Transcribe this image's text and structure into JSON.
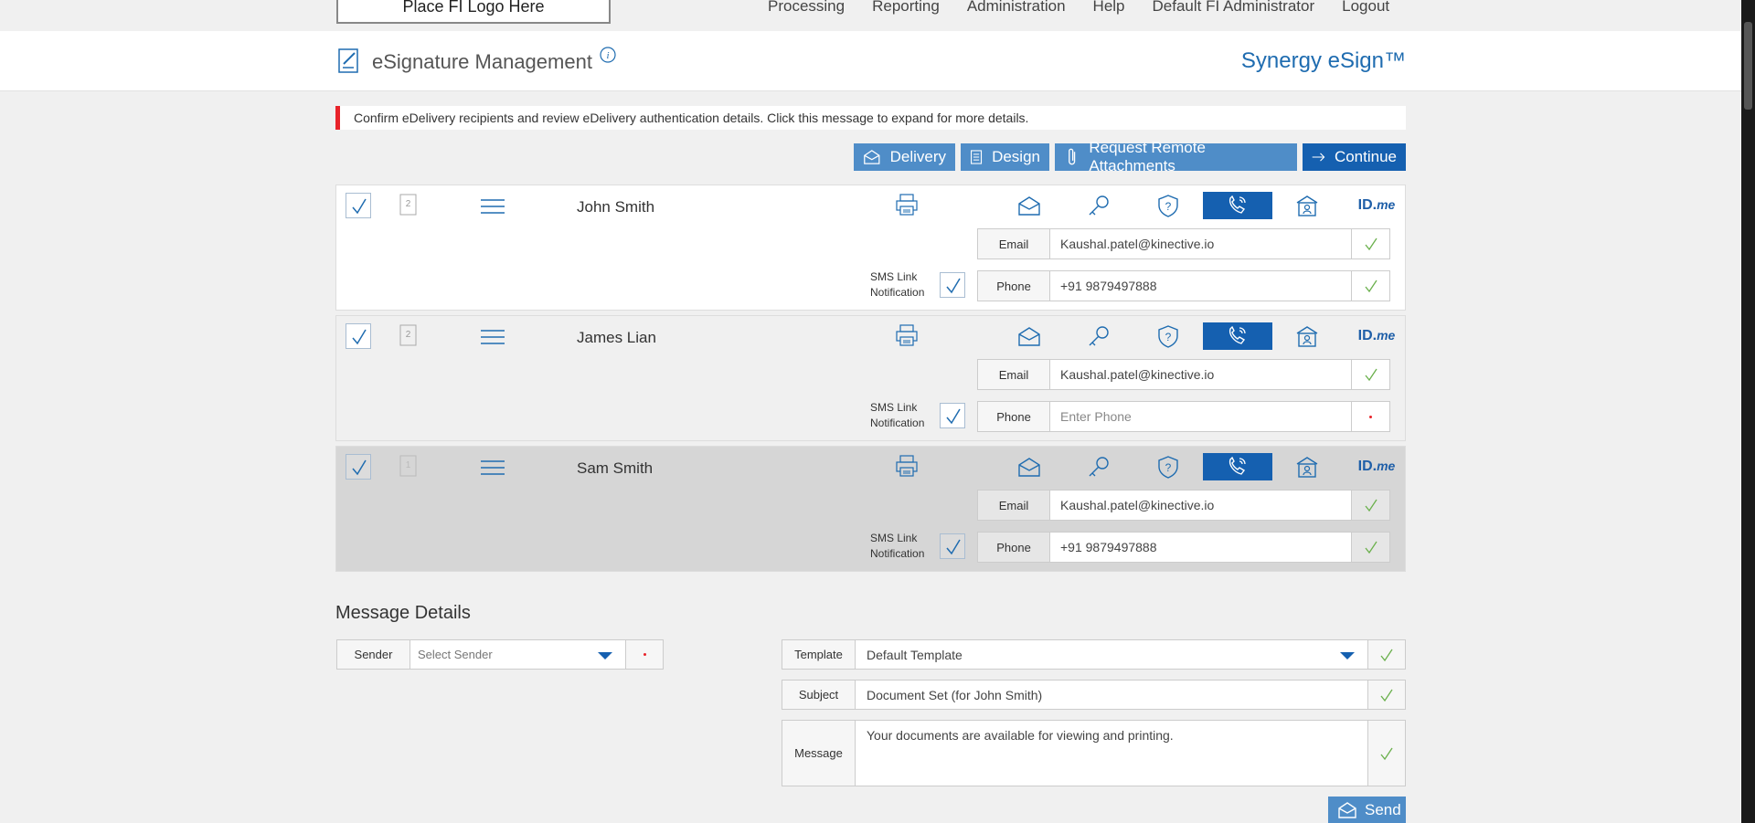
{
  "top_nav": {
    "logo_text": "Place FI Logo Here",
    "items": [
      "Processing",
      "Reporting",
      "Administration",
      "Help",
      "Default FI Administrator",
      "Logout"
    ]
  },
  "header": {
    "title": "eSignature Management",
    "brand": "Synergy eSign™"
  },
  "alert": {
    "text": "Confirm eDelivery recipients and review eDelivery authentication details. Click this message to expand for more details."
  },
  "actions": {
    "delivery": "Delivery",
    "design": "Design",
    "remote_attachments": "Request Remote Attachments",
    "continue": "Continue"
  },
  "recipients": [
    {
      "name": "John Smith",
      "order": "2",
      "email_label": "Email",
      "email": "Kaushal.patel@kinective.io",
      "phone_label": "Phone",
      "phone": "+91 9879497888",
      "phone_placeholder": "Enter Phone",
      "sms_label_1": "SMS Link",
      "sms_label_2": "Notification"
    },
    {
      "name": "James Lian",
      "order": "2",
      "email_label": "Email",
      "email": "Kaushal.patel@kinective.io",
      "phone_label": "Phone",
      "phone": "",
      "phone_placeholder": "Enter Phone",
      "sms_label_1": "SMS Link",
      "sms_label_2": "Notification"
    },
    {
      "name": "Sam Smith",
      "order": "1",
      "email_label": "Email",
      "email": "Kaushal.patel@kinective.io",
      "phone_label": "Phone",
      "phone": "+91 9879497888",
      "phone_placeholder": "Enter Phone",
      "sms_label_1": "SMS Link",
      "sms_label_2": "Notification"
    }
  ],
  "auth_icons": [
    "mail-lock-icon",
    "key-icon",
    "shield-question-icon",
    "phone-call-icon",
    "id-card-icon",
    "idme-logo"
  ],
  "idme": {
    "id": "ID.",
    "me": "me"
  },
  "message_details": {
    "title": "Message Details",
    "sender_label": "Sender",
    "sender_placeholder": "Select Sender",
    "template_label": "Template",
    "template_value": "Default Template",
    "subject_label": "Subject",
    "subject_value": "Document Set (for John Smith)",
    "message_label": "Message",
    "message_value": "Your documents are available for viewing and printing.",
    "send": "Send"
  },
  "colors": {
    "accent": "#1560b0",
    "button": "#4f8dc8",
    "alert": "#e8232a",
    "check": "#6ab04c"
  }
}
